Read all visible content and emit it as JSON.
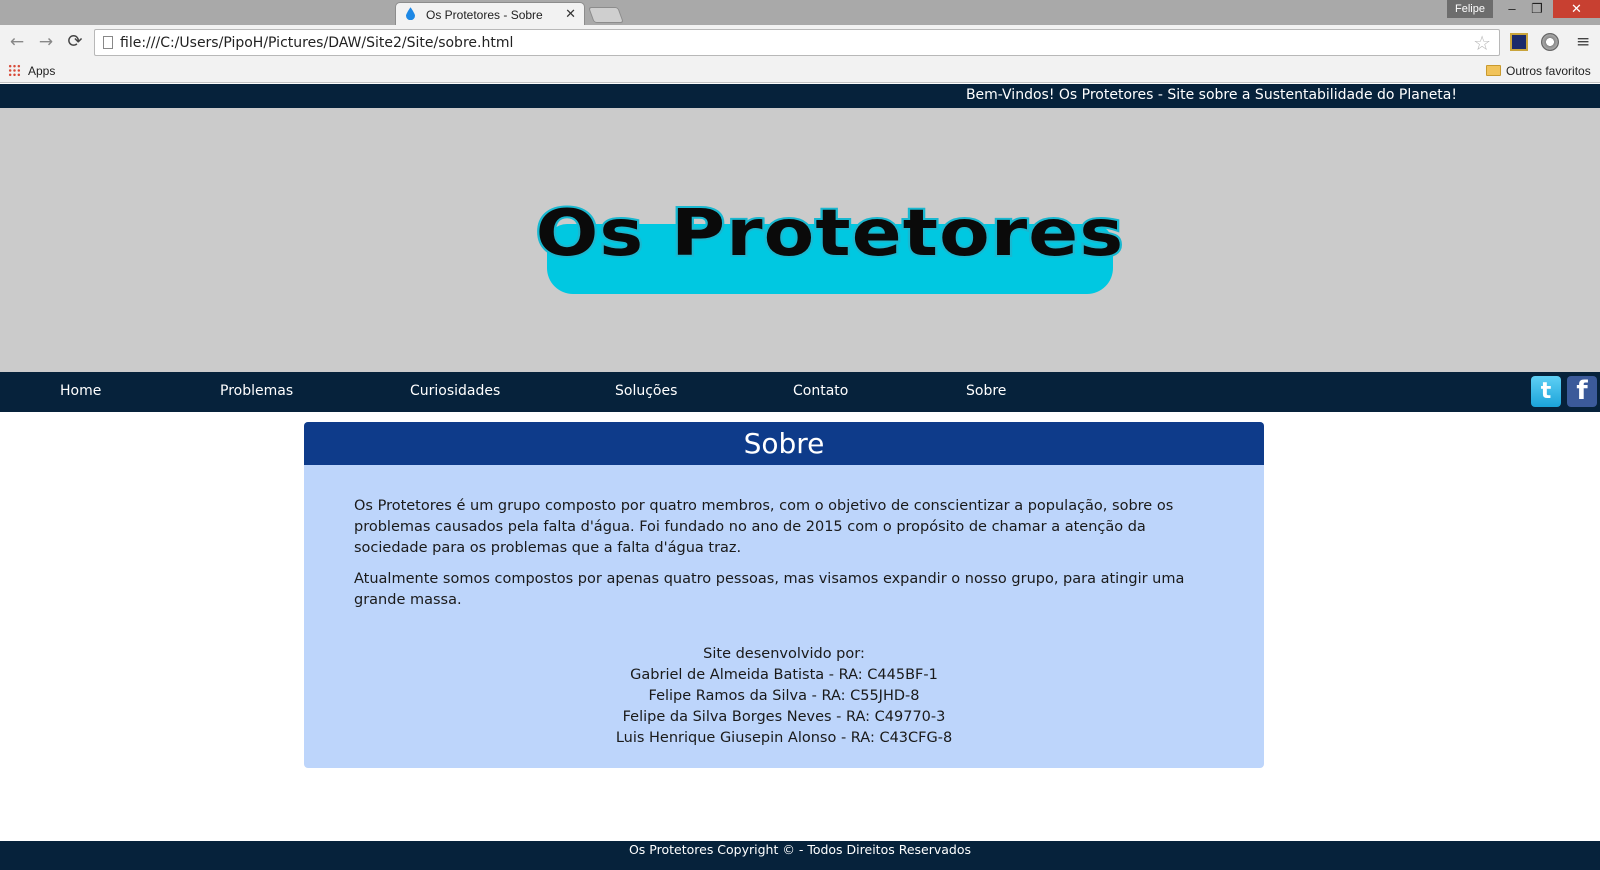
{
  "browser": {
    "tab_title": "Os Protetores - Sobre",
    "tab_close": "✕",
    "user_name": "Felipe",
    "window_controls": {
      "minimize": "–",
      "maximize": "❐",
      "close": "✕"
    },
    "nav": {
      "back": "←",
      "forward": "→",
      "reload": "⟳"
    },
    "url": "file:///C:/Users/PipoH/Pictures/DAW/Site2/Site/sobre.html",
    "star": "☆",
    "menu": "≡",
    "bookmarks": {
      "apps": "Apps",
      "other": "Outros favoritos"
    }
  },
  "site": {
    "welcome": "Bem-Vindos! Os Protetores - Site sobre a Sustentabilidade do Planeta!",
    "logo_text": "Os Protetores",
    "nav": [
      {
        "label": "Home"
      },
      {
        "label": "Problemas"
      },
      {
        "label": "Curiosidades"
      },
      {
        "label": "Soluções"
      },
      {
        "label": "Contato"
      },
      {
        "label": "Sobre"
      }
    ],
    "social": {
      "twitter": "t",
      "facebook": "f"
    },
    "about": {
      "title": "Sobre",
      "paragraphs": [
        "Os Protetores é um grupo composto por quatro membros, com o objetivo de conscientizar a população, sobre os problemas causados pela falta d'água. Foi fundado no ano de 2015 com o propósito de chamar a atenção da sociedade para os problemas que a falta d'água traz.",
        "Atualmente somos compostos por apenas quatro pessoas, mas visamos expandir o nosso grupo, para atingir uma grande massa."
      ],
      "credits_heading": "Site desenvolvido por:",
      "credits": [
        "Gabriel de Almeida Batista - RA: C445BF-1",
        "Felipe Ramos da Silva - RA: C55JHD-8",
        "Felipe da Silva Borges Neves - RA: C49770-3",
        "Luis Henrique Giusepin Alonso - RA: C43CFG-8"
      ]
    },
    "footer": "Os Protetores Copyright © - Todos Direitos Reservados"
  },
  "colors": {
    "dark_navy": "#06223b",
    "banner_gray": "#cbcbcb",
    "logo_cyan": "#00c8e1",
    "panel_header": "#0e3b8a",
    "panel_body": "#bdd5fb"
  }
}
